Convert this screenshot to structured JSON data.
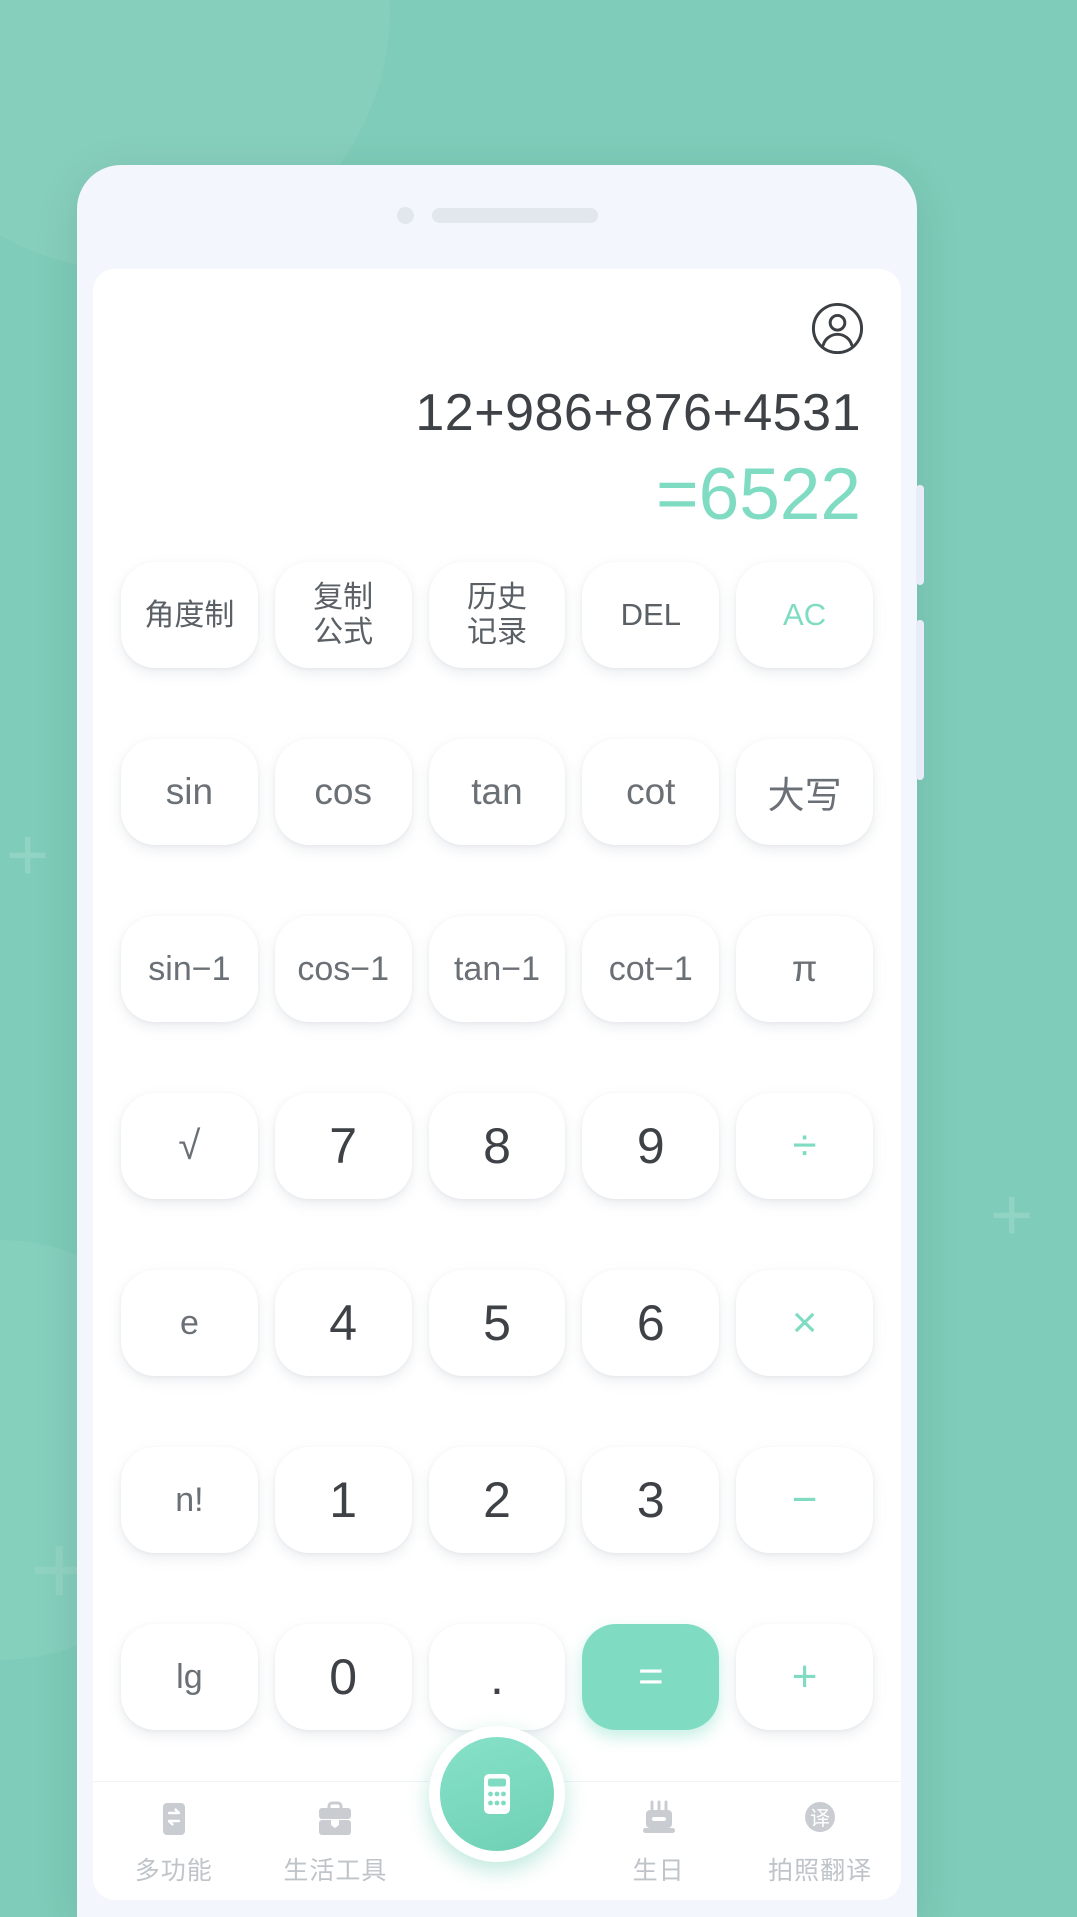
{
  "background": {
    "color": "#7ECCB9",
    "decor_plus": [
      "+",
      "+",
      "+"
    ]
  },
  "phone": {
    "frame_color": "#F3F6FD",
    "camera": "camera-dot",
    "speaker": "speaker-bar"
  },
  "header": {
    "avatar_icon": "user-circle-icon"
  },
  "display": {
    "expression": "12+986+876+4531",
    "result": "=6522",
    "result_color": "#7FDCC3",
    "expression_color": "#3E4246"
  },
  "keypad": {
    "rows": [
      [
        {
          "label": "角度制",
          "name": "key-degree-mode",
          "style": "fn-cjk"
        },
        {
          "label": "复制\n公式",
          "name": "key-copy-formula",
          "style": "fn-cjk"
        },
        {
          "label": "历史\n记录",
          "name": "key-history",
          "style": "fn-cjk"
        },
        {
          "label": "DEL",
          "name": "key-delete",
          "style": "fn"
        },
        {
          "label": "AC",
          "name": "key-all-clear",
          "style": "fn accent-text"
        }
      ],
      [
        {
          "label": "sin",
          "name": "key-sin",
          "style": "sci"
        },
        {
          "label": "cos",
          "name": "key-cos",
          "style": "sci"
        },
        {
          "label": "tan",
          "name": "key-tan",
          "style": "sci"
        },
        {
          "label": "cot",
          "name": "key-cot",
          "style": "sci"
        },
        {
          "label": "大写",
          "name": "key-uppercase",
          "style": "sci"
        }
      ],
      [
        {
          "label": "sin−1",
          "name": "key-arcsin",
          "style": "sci-sm"
        },
        {
          "label": "cos−1",
          "name": "key-arccos",
          "style": "sci-sm"
        },
        {
          "label": "tan−1",
          "name": "key-arctan",
          "style": "sci-sm"
        },
        {
          "label": "cot−1",
          "name": "key-arccot",
          "style": "sci-sm"
        },
        {
          "label": "π",
          "name": "key-pi",
          "style": "sci"
        }
      ],
      [
        {
          "label": "√",
          "name": "key-square-root",
          "style": "radical"
        },
        {
          "label": "7",
          "name": "key-7",
          "style": "num"
        },
        {
          "label": "8",
          "name": "key-8",
          "style": "num"
        },
        {
          "label": "9",
          "name": "key-9",
          "style": "num"
        },
        {
          "label": "÷",
          "name": "key-divide",
          "style": "op"
        }
      ],
      [
        {
          "label": "e",
          "name": "key-e",
          "style": "small"
        },
        {
          "label": "4",
          "name": "key-4",
          "style": "num"
        },
        {
          "label": "5",
          "name": "key-5",
          "style": "num"
        },
        {
          "label": "6",
          "name": "key-6",
          "style": "num"
        },
        {
          "label": "×",
          "name": "key-multiply",
          "style": "op"
        }
      ],
      [
        {
          "label": "n!",
          "name": "key-factorial",
          "style": "small"
        },
        {
          "label": "1",
          "name": "key-1",
          "style": "num"
        },
        {
          "label": "2",
          "name": "key-2",
          "style": "num"
        },
        {
          "label": "3",
          "name": "key-3",
          "style": "num"
        },
        {
          "label": "−",
          "name": "key-subtract",
          "style": "op"
        }
      ],
      [
        {
          "label": "lg",
          "name": "key-log10",
          "style": "small"
        },
        {
          "label": "0",
          "name": "key-0",
          "style": "num"
        },
        {
          "label": ".",
          "name": "key-decimal-point",
          "style": "num"
        },
        {
          "label": "=",
          "name": "key-equals",
          "style": "equals"
        },
        {
          "label": "+",
          "name": "key-add",
          "style": "op"
        }
      ]
    ]
  },
  "bottom_nav": {
    "items": [
      {
        "label": "多功能",
        "icon": "multifunction-icon",
        "name": "nav-multifunction"
      },
      {
        "label": "生活工具",
        "icon": "toolbox-icon",
        "name": "nav-life-tools"
      },
      {
        "label": "生日",
        "icon": "birthday-cake-icon",
        "name": "nav-birthday"
      },
      {
        "label": "拍照翻译",
        "icon": "translate-icon",
        "name": "nav-photo-translate"
      }
    ],
    "fab": {
      "icon": "calculator-icon",
      "name": "nav-calculator-fab",
      "color": "#7FDCC3"
    },
    "label_color": "#BFC4C9"
  }
}
